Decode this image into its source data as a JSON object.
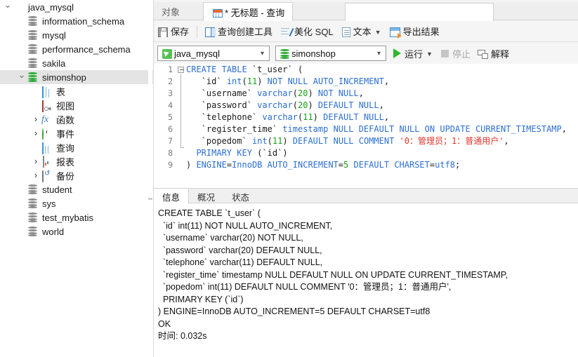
{
  "sidebar": {
    "items": [
      {
        "twisty": "open",
        "icon": "connection-icon",
        "label": "java_mysql",
        "indent": 0,
        "selected": false
      },
      {
        "twisty": "none",
        "icon": "database-icon",
        "label": "information_schema",
        "indent": 1,
        "selected": false
      },
      {
        "twisty": "none",
        "icon": "database-icon",
        "label": "mysql",
        "indent": 1,
        "selected": false
      },
      {
        "twisty": "none",
        "icon": "database-icon",
        "label": "performance_schema",
        "indent": 1,
        "selected": false
      },
      {
        "twisty": "none",
        "icon": "database-icon",
        "label": "sakila",
        "indent": 1,
        "selected": false
      },
      {
        "twisty": "open",
        "icon": "database-green-icon",
        "label": "simonshop",
        "indent": 1,
        "selected": true
      },
      {
        "twisty": "none",
        "icon": "table-icon",
        "label": "表",
        "indent": 2,
        "selected": false
      },
      {
        "twisty": "none",
        "icon": "view-icon",
        "label": "视图",
        "indent": 2,
        "selected": false
      },
      {
        "twisty": "closed",
        "icon": "function-icon",
        "label": "函数",
        "indent": 2,
        "selected": false
      },
      {
        "twisty": "closed",
        "icon": "event-clock-icon",
        "label": "事件",
        "indent": 2,
        "selected": false
      },
      {
        "twisty": "none",
        "icon": "query-icon",
        "label": "查询",
        "indent": 2,
        "selected": false
      },
      {
        "twisty": "closed",
        "icon": "report-icon",
        "label": "报表",
        "indent": 2,
        "selected": false
      },
      {
        "twisty": "closed",
        "icon": "backup-icon",
        "label": "备份",
        "indent": 2,
        "selected": false
      },
      {
        "twisty": "none",
        "icon": "database-icon",
        "label": "student",
        "indent": 1,
        "selected": false
      },
      {
        "twisty": "none",
        "icon": "database-icon",
        "label": "sys",
        "indent": 1,
        "selected": false
      },
      {
        "twisty": "none",
        "icon": "database-icon",
        "label": "test_mybatis",
        "indent": 1,
        "selected": false
      },
      {
        "twisty": "none",
        "icon": "database-icon",
        "label": "world",
        "indent": 1,
        "selected": false
      }
    ]
  },
  "tabs": {
    "object_tab": "对象",
    "query_tab": "* 无标题 - 查询"
  },
  "toolbar": {
    "save": "保存",
    "query_builder": "查询创建工具",
    "beautify_sql": "美化 SQL",
    "text": "文本",
    "export_result": "导出结果"
  },
  "selectors": {
    "connection": "java_mysql",
    "database": "simonshop",
    "run": "运行",
    "stop": "停止",
    "explain": "解释"
  },
  "editor": {
    "line_numbers": [
      "1",
      "2",
      "3",
      "4",
      "5",
      "6",
      "7",
      "8",
      "9"
    ],
    "lines": [
      "CREATE TABLE `t_user` (",
      "   `id` int(11) NOT NULL AUTO_INCREMENT,",
      "   `username` varchar(20) NOT NULL,",
      "   `password` varchar(20) DEFAULT NULL,",
      "   `telephone` varchar(11) DEFAULT NULL,",
      "   `register_time` timestamp NULL DEFAULT NULL ON UPDATE CURRENT_TIMESTAMP,",
      "   `popedom` int(11) DEFAULT NULL COMMENT '0：管理员；1：普通用户',",
      "  PRIMARY KEY (`id`)",
      ") ENGINE=InnoDB AUTO_INCREMENT=5 DEFAULT CHARSET=utf8;"
    ]
  },
  "result_tabs": [
    {
      "label": "信息",
      "selected": true
    },
    {
      "label": "概况",
      "selected": false
    },
    {
      "label": "状态",
      "selected": false
    }
  ],
  "output": {
    "text": "CREATE TABLE `t_user` (\n  `id` int(11) NOT NULL AUTO_INCREMENT,\n  `username` varchar(20) NOT NULL,\n  `password` varchar(20) DEFAULT NULL,\n  `telephone` varchar(11) DEFAULT NULL,\n  `register_time` timestamp NULL DEFAULT NULL ON UPDATE CURRENT_TIMESTAMP,\n  `popedom` int(11) DEFAULT NULL COMMENT '0：管理员；1：普通用户',\n  PRIMARY KEY (`id`)\n) ENGINE=InnoDB AUTO_INCREMENT=5 DEFAULT CHARSET=utf8\nOK\n时间: 0.032s"
  },
  "colors": {
    "accent_green": "#2eb82e",
    "keyword_blue": "#2b6fd1",
    "number_green": "#18a018",
    "string_red": "#e0352b",
    "selection_grey": "#e4e4e4"
  }
}
